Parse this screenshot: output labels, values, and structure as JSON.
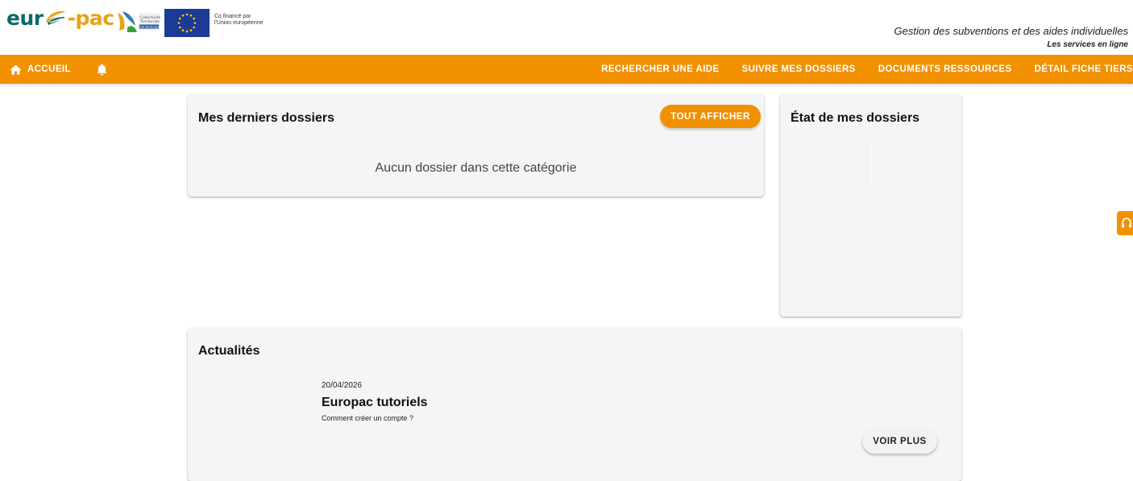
{
  "header": {
    "logo_text_left": "eur",
    "logo_text_right": "-pac",
    "cofinance_line1": "Co financé par",
    "cofinance_line2": "l'Union européenne",
    "site_title": "Gestion des subventions et des aides individuelles",
    "site_subtitle": "Les services en ligne"
  },
  "nav": {
    "home_label": "ACCUEIL",
    "items": [
      {
        "label": "RECHERCHER UNE AIDE"
      },
      {
        "label": "SUIVRE MES DOSSIERS"
      },
      {
        "label": "DOCUMENTS RESSOURCES"
      },
      {
        "label": "DÉTAIL FICHE TIERS"
      }
    ]
  },
  "dossiers_card": {
    "title": "Mes derniers dossiers",
    "show_all_label": "TOUT AFFICHER",
    "empty_message": "Aucun dossier dans cette catégorie"
  },
  "etat_card": {
    "title": "État de mes dossiers"
  },
  "news_card": {
    "title": "Actualités",
    "item": {
      "date": "20/04/2026",
      "title": "Europac tutoriels",
      "text": "Comment créer un compte ?"
    },
    "more_label": "VOIR PLUS"
  },
  "colors": {
    "accent": "#f29100",
    "brand_teal": "#0d6a6a",
    "eu_blue": "#1d3a97",
    "card_bg": "#f5f5f5"
  },
  "icons": [
    "home-icon",
    "bell-icon",
    "headset-icon",
    "leaf-icon"
  ]
}
